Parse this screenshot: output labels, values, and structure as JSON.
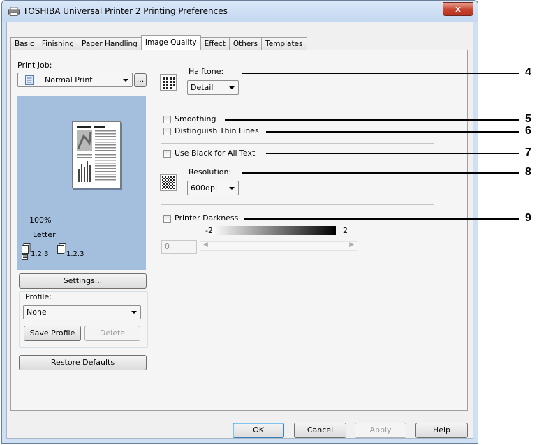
{
  "window": {
    "title": "TOSHIBA Universal Printer 2 Printing Preferences",
    "close_label": "x"
  },
  "tabs": [
    {
      "label": "Basic"
    },
    {
      "label": "Finishing"
    },
    {
      "label": "Paper Handling"
    },
    {
      "label": "Image Quality",
      "active": true
    },
    {
      "label": "Effect"
    },
    {
      "label": "Others"
    },
    {
      "label": "Templates"
    }
  ],
  "left": {
    "print_job_label": "Print Job:",
    "print_job_value": "Normal Print",
    "browse_label": "...",
    "preview": {
      "zoom": "100%",
      "paper": "Letter",
      "collate_1": "1.2.3",
      "collate_2": "1.2.3"
    },
    "settings_button": "Settings...",
    "profile_label": "Profile:",
    "profile_value": "None",
    "save_profile_button": "Save Profile",
    "delete_button": "Delete",
    "restore_defaults_button": "Restore Defaults"
  },
  "image_quality": {
    "halftone_label": "Halftone:",
    "halftone_value": "Detail",
    "smoothing_label": "Smoothing",
    "thin_lines_label": "Distinguish Thin Lines",
    "black_text_label": "Use Black for All Text",
    "resolution_label": "Resolution:",
    "resolution_value": "600dpi",
    "darkness_label": "Printer Darkness",
    "darkness_min": "-2",
    "darkness_max": "2",
    "darkness_value": "0"
  },
  "callouts": [
    "4",
    "5",
    "6",
    "7",
    "8",
    "9"
  ],
  "footer": {
    "ok": "OK",
    "cancel": "Cancel",
    "apply": "Apply",
    "help": "Help"
  }
}
